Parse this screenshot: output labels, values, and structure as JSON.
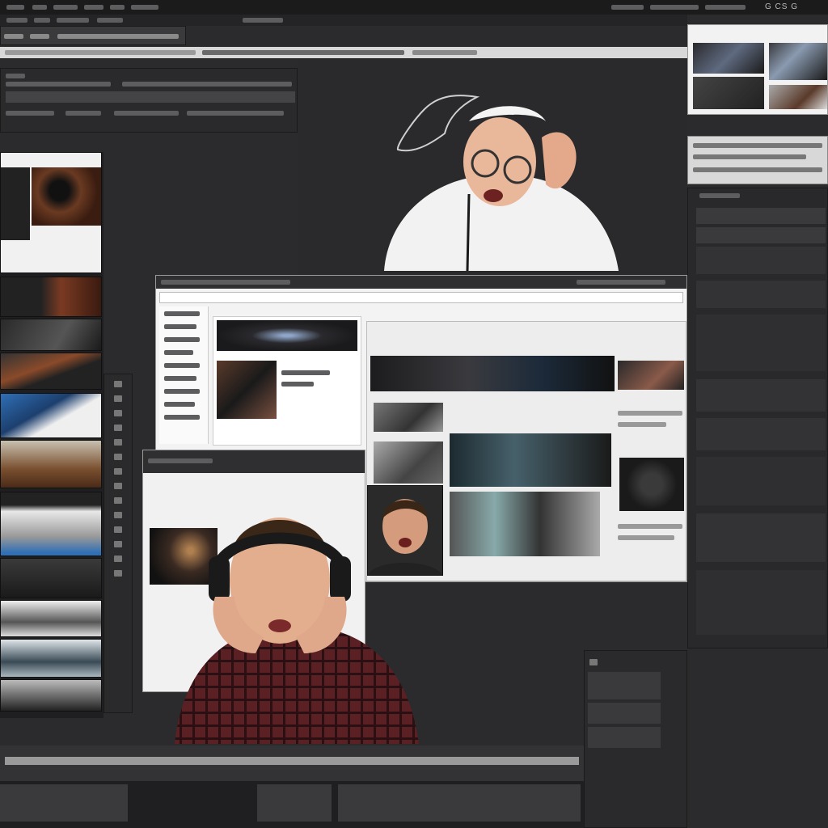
{
  "top_bar": {
    "right_label": "G CS G"
  },
  "panels": {
    "left_column": {
      "thumb_count": 10
    },
    "center_window": {},
    "right_panel": {}
  },
  "scene": {
    "person_top": {
      "label": ""
    },
    "person_main": {
      "label": ""
    },
    "person_small": {
      "label": ""
    }
  },
  "colors": {
    "app_bg": "#2b2b2d",
    "panel_dark": "#303032",
    "panel_light": "#e9e9e9",
    "accent_blue": "#2f6fb5"
  }
}
